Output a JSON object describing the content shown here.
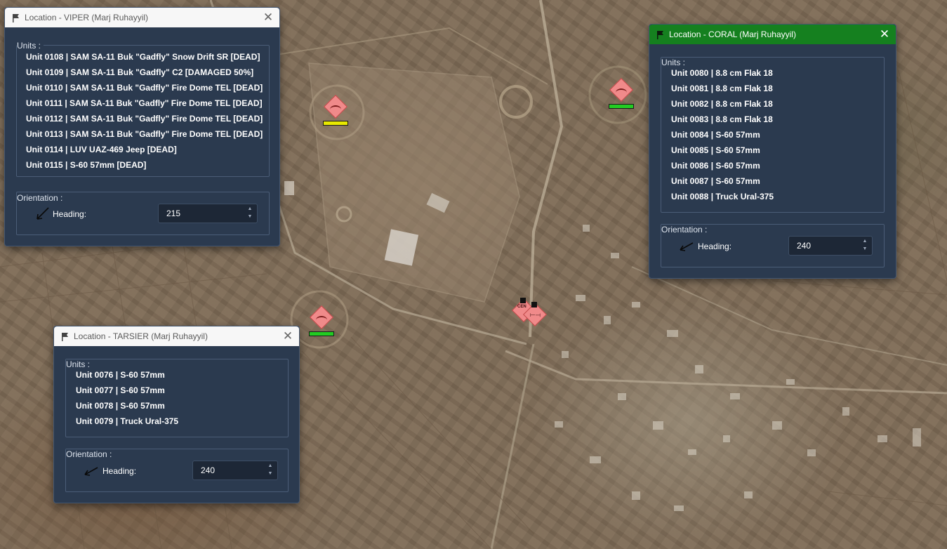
{
  "colors": {
    "dialog_bg": "#2b3a4f",
    "active_title_bg": "#15801f",
    "marker_fill": "#f08a8a",
    "health_green": "#22cc22",
    "health_yellow": "#e8e800"
  },
  "markers": [
    {
      "health": "yellow"
    },
    {
      "health": "green"
    },
    {
      "health": "green"
    },
    {
      "labels": [
        "CEN"
      ]
    }
  ],
  "viper": {
    "title": "Location - VIPER (Marj Ruhayyil)",
    "close": "✕",
    "units_label": "Units :",
    "units": [
      "Unit 0108 | SAM SA-11 Buk \"Gadfly\" Snow Drift SR [DEAD]",
      "Unit 0109 | SAM SA-11 Buk \"Gadfly\" C2 [DAMAGED 50%]",
      "Unit 0110 | SAM SA-11 Buk \"Gadfly\" Fire Dome TEL [DEAD]",
      "Unit 0111 | SAM SA-11 Buk \"Gadfly\" Fire Dome TEL [DEAD]",
      "Unit 0112 | SAM SA-11 Buk \"Gadfly\" Fire Dome TEL [DEAD]",
      "Unit 0113 | SAM SA-11 Buk \"Gadfly\" Fire Dome TEL [DEAD]",
      "Unit 0114 | LUV UAZ-469 Jeep [DEAD]",
      "Unit 0115 | S-60 57mm [DEAD]"
    ],
    "orientation_label": "Orientation :",
    "heading_label": "Heading:",
    "heading_value": "215"
  },
  "coral": {
    "title": "Location - CORAL (Marj Ruhayyil)",
    "close": "✕",
    "units_label": "Units :",
    "units": [
      "Unit 0080 | 8.8 cm Flak 18",
      "Unit 0081 | 8.8 cm Flak 18",
      "Unit 0082 | 8.8 cm Flak 18",
      "Unit 0083 | 8.8 cm Flak 18",
      "Unit 0084 | S-60 57mm",
      "Unit 0085 | S-60 57mm",
      "Unit 0086 | S-60 57mm",
      "Unit 0087 | S-60 57mm",
      "Unit 0088 | Truck Ural-375"
    ],
    "orientation_label": "Orientation :",
    "heading_label": "Heading:",
    "heading_value": "240"
  },
  "tarsier": {
    "title": "Location - TARSIER (Marj Ruhayyil)",
    "close": "✕",
    "units_label": "Units :",
    "units": [
      "Unit 0076 | S-60 57mm",
      "Unit 0077 | S-60 57mm",
      "Unit 0078 | S-60 57mm",
      "Unit 0079 | Truck Ural-375"
    ],
    "orientation_label": "Orientation :",
    "heading_label": "Heading:",
    "heading_value": "240"
  },
  "icons": {
    "title": "flag-icon",
    "close": "close-icon",
    "heading": "heading-arrow-icon",
    "spin_up": "chevron-up-icon",
    "spin_down": "chevron-down-icon"
  }
}
